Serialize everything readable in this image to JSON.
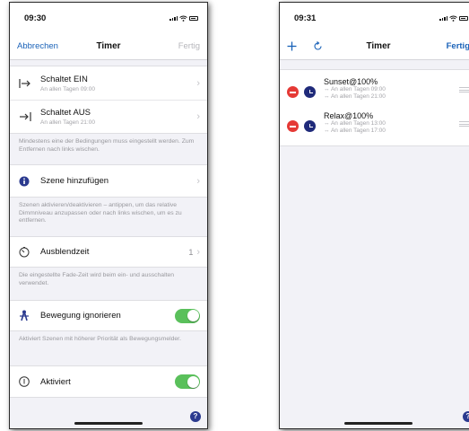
{
  "left": {
    "status_time": "09:30",
    "nav": {
      "cancel": "Abbrechen",
      "title": "Timer",
      "done": "Fertig"
    },
    "switch_on": {
      "title": "Schaltet EIN",
      "sub": "An allen Tagen 09:00"
    },
    "switch_off": {
      "title": "Schaltet AUS",
      "sub": "An allen Tagen 21:00"
    },
    "conditions_note": "Mindestens eine der Bedingungen muss eingestellt werden. Zum Entfernen nach links wischen.",
    "add_scene": {
      "title": "Szene hinzufügen"
    },
    "scene_note": "Szenen aktivieren/deaktivieren – antippen, um das relative Dimmniveau anzupassen oder nach links wischen, um es zu entfernen.",
    "fade": {
      "title": "Ausblendzeit",
      "value": "1"
    },
    "fade_note": "Die eingestellte Fade-Zeit wird beim ein- und ausschalten verwendet.",
    "motion": {
      "title": "Bewegung ignorieren",
      "on": true
    },
    "motion_note": "Aktiviert Szenen mit höherer Priorität als Bewegungsmelder.",
    "active": {
      "title": "Aktiviert",
      "on": true
    },
    "help": "?"
  },
  "right": {
    "status_time": "09:31",
    "nav": {
      "title": "Timer",
      "done": "Fertig"
    },
    "timers": [
      {
        "title": "Sunset@100%",
        "line1": "↔ An allen Tagen 09:00",
        "line2": "↔ An allen Tagen 21:00"
      },
      {
        "title": "Relax@100%",
        "line1": "↔ An allen Tagen 13:00",
        "line2": "↔ An allen Tagen 17:00"
      }
    ],
    "help": "?"
  },
  "colors": {
    "accent": "#1a62b8",
    "toggle_on": "#5ac05b",
    "delete": "#e53935",
    "clock": "#1f2a7a"
  },
  "icons": [
    "arrow-in-icon",
    "arrow-out-icon",
    "info-icon",
    "timer-icon",
    "motion-icon",
    "power-icon",
    "plus-icon",
    "refresh-icon",
    "delete-icon",
    "clock-icon",
    "drag-handle-icon",
    "help-icon"
  ]
}
